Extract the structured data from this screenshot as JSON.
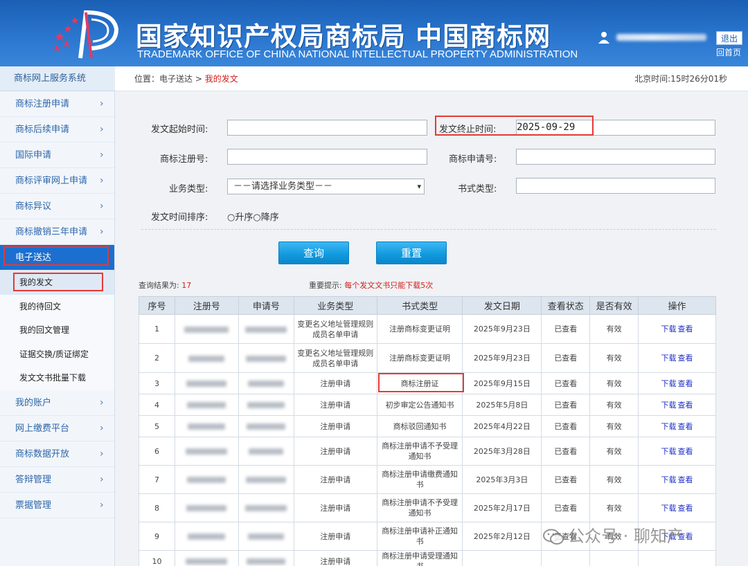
{
  "header": {
    "title_cn": "国家知识产权局商标局 中国商标网",
    "title_en": "TRADEMARK OFFICE OF CHINA NATIONAL INTELLECTUAL PROPERTY ADMINISTRATION",
    "logout_label": "退出",
    "home_label": "回首页"
  },
  "topbar": {
    "system_name": "商标网上服务系统",
    "breadcrumb_prefix": "位置：",
    "breadcrumb_parent": "电子送达",
    "breadcrumb_sep": " > ",
    "breadcrumb_current": "我的发文",
    "clock": "北京时间:15时26分01秒"
  },
  "sidebar": {
    "items": [
      {
        "label": "商标注册申请"
      },
      {
        "label": "商标后续申请"
      },
      {
        "label": "国际申请"
      },
      {
        "label": "商标评审网上申请"
      },
      {
        "label": "商标异议"
      },
      {
        "label": "商标撤销三年申请"
      }
    ],
    "active_label": "电子送达",
    "sub_items": [
      {
        "label": "我的发文"
      },
      {
        "label": "我的待回文"
      },
      {
        "label": "我的回文管理"
      },
      {
        "label": "证据交换/质证绑定"
      },
      {
        "label": "发文文书批量下载"
      }
    ],
    "items_after": [
      {
        "label": "我的账户"
      },
      {
        "label": "网上缴费平台"
      },
      {
        "label": "商标数据开放"
      },
      {
        "label": "答辩管理"
      },
      {
        "label": "票据管理"
      }
    ],
    "chevron": "›"
  },
  "form": {
    "start_label": "发文起始时间:",
    "end_label": "发文终止时间:",
    "end_value": "2025-09-29",
    "reg_no_label": "商标注册号:",
    "app_no_label": "商标申请号:",
    "biz_type_label": "业务类型:",
    "biz_type_value": "－－请选择业务类型－－",
    "doc_type_label": "书式类型:",
    "sort_label": "发文时间排序:",
    "sort_asc": "升序",
    "sort_desc": "降序",
    "query_button": "查询",
    "reset_button": "重置"
  },
  "result": {
    "count_label": "查询结果为:",
    "count": "17",
    "tip_label": "重要提示:",
    "tip_text": "每个发文文书只能下载5次"
  },
  "table": {
    "headers": [
      "序号",
      "注册号",
      "申请号",
      "业务类型",
      "书式类型",
      "发文日期",
      "查看状态",
      "是否有效",
      "操作"
    ],
    "rows": [
      {
        "no": "1",
        "biz": "变更名义地址管理规则成员名单申请",
        "doc": "注册商标变更证明",
        "date": "2025年9月23日",
        "status": "已查看",
        "valid": "有效",
        "dl": "下载",
        "view": "查看"
      },
      {
        "no": "2",
        "biz": "变更名义地址管理规则成员名单申请",
        "doc": "注册商标变更证明",
        "date": "2025年9月23日",
        "status": "已查看",
        "valid": "有效",
        "dl": "下载",
        "view": "查看"
      },
      {
        "no": "3",
        "biz": "注册申请",
        "doc": "商标注册证",
        "date": "2025年9月15日",
        "status": "已查看",
        "valid": "有效",
        "dl": "下载",
        "view": "查看"
      },
      {
        "no": "4",
        "biz": "注册申请",
        "doc": "初步审定公告通知书",
        "date": "2025年5月8日",
        "status": "已查看",
        "valid": "有效",
        "dl": "下载",
        "view": "查看"
      },
      {
        "no": "5",
        "biz": "注册申请",
        "doc": "商标驳回通知书",
        "date": "2025年4月22日",
        "status": "已查看",
        "valid": "有效",
        "dl": "下载",
        "view": "查看"
      },
      {
        "no": "6",
        "biz": "注册申请",
        "doc": "商标注册申请不予受理通知书",
        "date": "2025年3月28日",
        "status": "已查看",
        "valid": "有效",
        "dl": "下载",
        "view": "查看"
      },
      {
        "no": "7",
        "biz": "注册申请",
        "doc": "商标注册申请缴费通知书",
        "date": "2025年3月3日",
        "status": "已查看",
        "valid": "有效",
        "dl": "下载",
        "view": "查看"
      },
      {
        "no": "8",
        "biz": "注册申请",
        "doc": "商标注册申请不予受理通知书",
        "date": "2025年2月17日",
        "status": "已查看",
        "valid": "有效",
        "dl": "下载",
        "view": "查看"
      },
      {
        "no": "9",
        "biz": "注册申请",
        "doc": "商标注册申请补正通知书",
        "date": "2025年2月12日",
        "status": "已查看",
        "valid": "有效",
        "dl": "下载",
        "view": "查看"
      },
      {
        "no": "10",
        "biz": "注册申请",
        "doc": "商标注册申请受理通知书",
        "date": "",
        "status": "",
        "valid": "",
        "dl": "",
        "view": ""
      }
    ]
  },
  "watermark": {
    "text": "公众号 · 聊知产"
  },
  "colors": {
    "header_blue": "#1a5fb4",
    "highlight_red": "#e53935",
    "link_blue": "#1d2fc8",
    "button_blue": "#129bdf"
  }
}
